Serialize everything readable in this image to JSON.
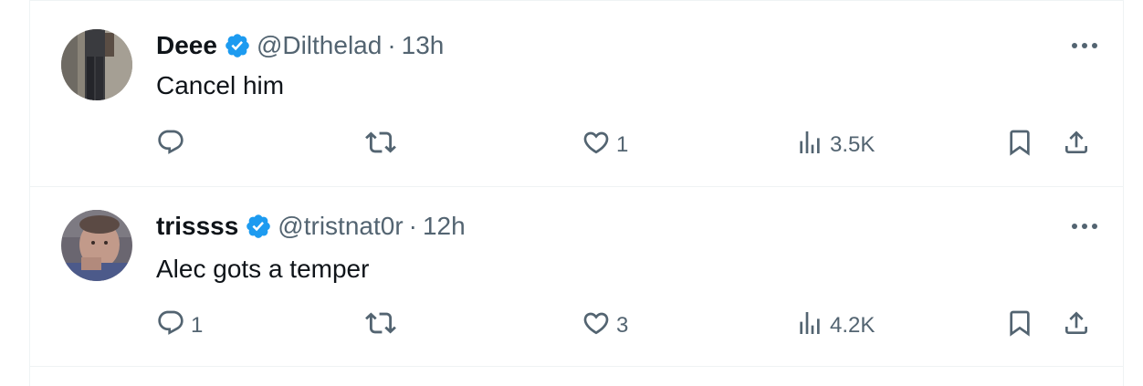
{
  "tweets": [
    {
      "name": "Deee",
      "handle": "@Dilthelad",
      "dot": "·",
      "time": "13h",
      "text": "Cancel him",
      "replies": "",
      "retweets": "",
      "likes": "1",
      "views": "3.5K"
    },
    {
      "name": "trissss",
      "handle": "@tristnat0r",
      "dot": "·",
      "time": "12h",
      "text": "Alec gots a temper",
      "replies": "1",
      "retweets": "",
      "likes": "3",
      "views": "4.2K"
    }
  ],
  "colors": {
    "verified": "#1d9bf0",
    "secondary_text": "#536471",
    "primary_text": "#0f1419",
    "border": "#eff3f4"
  },
  "icons": [
    "verified-badge-icon",
    "more-icon",
    "reply-icon",
    "retweet-icon",
    "like-icon",
    "views-icon",
    "bookmark-icon",
    "share-icon"
  ]
}
